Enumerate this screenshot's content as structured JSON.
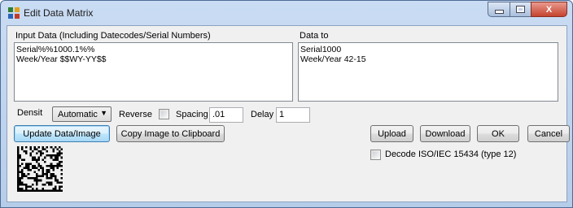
{
  "window": {
    "title": "Edit Data Matrix",
    "minimize_icon": "minimize-icon",
    "maximize_icon": "maximize-icon",
    "close_icon": "close-icon",
    "close_symbol": "X"
  },
  "input_panel": {
    "label": "Input Data (Including Datecodes/Serial Numbers)",
    "lines": [
      "Serial%%1000.1%%",
      "Week/Year $$WY-YY$$"
    ]
  },
  "output_panel": {
    "label": "Data to",
    "lines": [
      "Serial1000",
      "Week/Year 42-15"
    ]
  },
  "options": {
    "density_label": "Densit",
    "density_value": "Automatic",
    "reverse_label": "Reverse",
    "spacing_label": "Spacing",
    "spacing_value": ".01",
    "delay_label": "Delay",
    "delay_value": "1"
  },
  "buttons": {
    "update": "Update Data/Image",
    "copy": "Copy Image to Clipboard",
    "upload": "Upload",
    "download": "Download",
    "ok": "OK",
    "cancel": "Cancel"
  },
  "decode_label": "Decode ISO/IEC 15434 (type 12)",
  "barcode_icon": "data-matrix-barcode"
}
